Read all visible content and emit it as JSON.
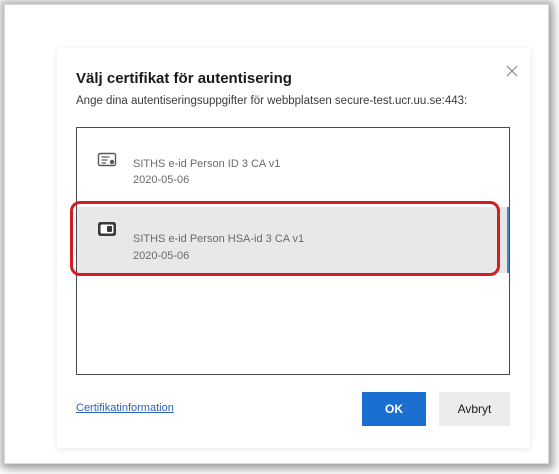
{
  "dialog": {
    "title": "Välj certifikat för autentisering",
    "subtitle": "Ange dina autentiseringsuppgifter för webbplatsen secure-test.ucr.uu.se:443:",
    "close_icon": "close-icon",
    "certificates": [
      {
        "name": "SITHS e-id Person ID 3 CA v1",
        "date": "2020-05-06",
        "icon": "certificate-card-icon",
        "selected": false
      },
      {
        "name": "SITHS e-id Person HSA-id 3 CA v1",
        "date": "2020-05-06",
        "icon": "smart-card-icon",
        "selected": true
      }
    ],
    "cert_info_link": "Certifikatinformation",
    "ok_label": "OK",
    "cancel_label": "Avbryt"
  },
  "colors": {
    "primary_button": "#1a6fd1",
    "highlight_border": "#d41c24",
    "link": "#2a63b5",
    "selected_row": "#e8e8e8"
  }
}
